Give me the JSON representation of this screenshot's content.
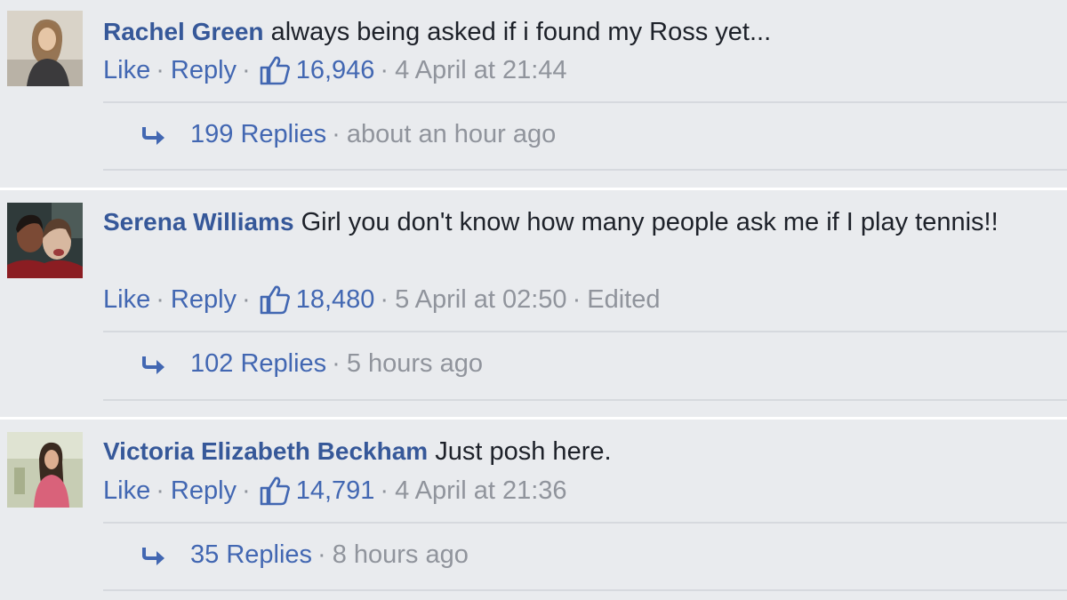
{
  "comments": [
    {
      "author": "Rachel Green",
      "text": "always being asked if i found my Ross yet...",
      "actions": {
        "like": "Like",
        "reply": "Reply",
        "separator": "·"
      },
      "likes": "16,946",
      "timestamp": "4 April at 21:44",
      "edited": "",
      "replies": {
        "label": "199 Replies",
        "time": "about an hour ago"
      },
      "avatar_icon": "user-avatar"
    },
    {
      "author": "Serena Williams",
      "text": "Girl you don't know how many people ask me if I play tennis!!",
      "actions": {
        "like": "Like",
        "reply": "Reply",
        "separator": "·"
      },
      "likes": "18,480",
      "timestamp": "5 April at 02:50",
      "edited": "Edited",
      "replies": {
        "label": "102 Replies",
        "time": "5 hours ago"
      },
      "avatar_icon": "user-avatar"
    },
    {
      "author": "Victoria Elizabeth Beckham",
      "text": "Just posh here.",
      "actions": {
        "like": "Like",
        "reply": "Reply",
        "separator": "·"
      },
      "likes": "14,791",
      "timestamp": "4 April at 21:36",
      "edited": "",
      "replies": {
        "label": "35 Replies",
        "time": "8 hours ago"
      },
      "avatar_icon": "user-avatar"
    }
  ],
  "icons": {
    "like": "thumbs-up-icon",
    "replies": "reply-arrow-icon"
  },
  "colors": {
    "background": "#e9ebee",
    "author": "#365899",
    "link": "#4267b2",
    "muted": "#90949c",
    "text": "#1d2129"
  }
}
